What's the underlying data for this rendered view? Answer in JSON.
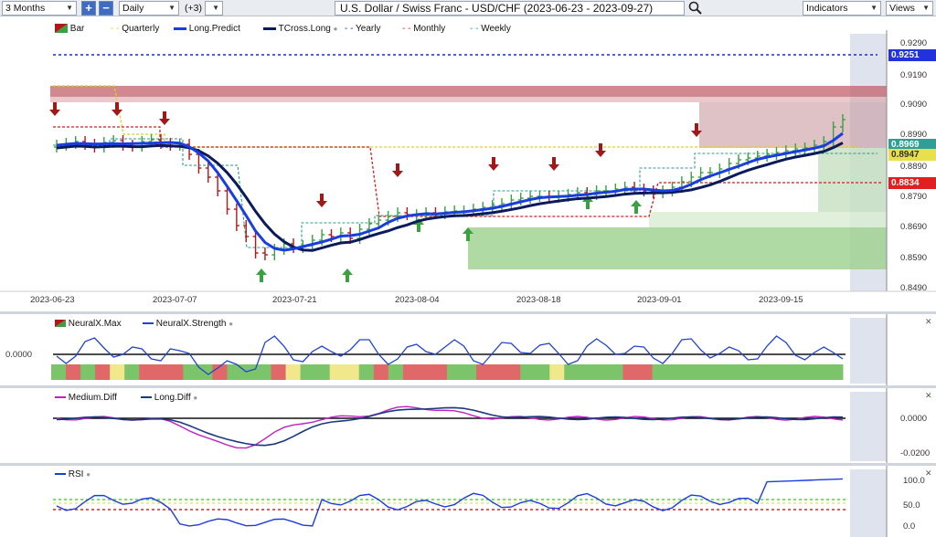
{
  "toolbar": {
    "period": "3 Months",
    "interval": "Daily",
    "plus_count": "(+3)",
    "title": "U.S. Dollar / Swiss Franc - USD/CHF (2023-06-23 - 2023-09-27)",
    "indicators_label": "Indicators",
    "views_label": "Views",
    "zoom_in": "+",
    "zoom_out": "−"
  },
  "main_chart": {
    "legend": [
      "Bar",
      "Quarterly",
      "Long.Predict",
      "TCross.Long",
      "Yearly",
      "Monthly",
      "Weekly"
    ],
    "y_ticks": [
      "0.9290",
      "0.9190",
      "0.9090",
      "0.8990",
      "0.8890",
      "0.8790",
      "0.8690",
      "0.8590",
      "0.8490"
    ],
    "x_ticks": [
      "2023-06-23",
      "2023-07-07",
      "2023-07-21",
      "2023-08-04",
      "2023-08-18",
      "2023-09-01",
      "2023-09-15"
    ],
    "price_tags": [
      {
        "label": "0.9251",
        "color": "#2233dd"
      },
      {
        "label": "0.8969",
        "color": "#2f9e96"
      },
      {
        "label": "0.8947",
        "color": "#e8e04a"
      },
      {
        "label": "0.8834",
        "color": "#e02020"
      }
    ]
  },
  "neural_panel": {
    "legend": [
      "NeuralX.Max",
      "NeuralX.Strength"
    ],
    "y_label": "0.0000"
  },
  "diff_panel": {
    "legend": [
      "Medium.Diff",
      "Long.Diff"
    ],
    "y_ticks": [
      "0.0000",
      "-0.0200"
    ]
  },
  "rsi_panel": {
    "legend": [
      "RSI"
    ],
    "y_ticks": [
      "100.0",
      "50.0",
      "0.0"
    ]
  },
  "colors": {
    "long_predict": "#1a3de0",
    "tcross_long": "#0a1a5a",
    "yearly": "#1a2bd0",
    "monthly": "#d02020",
    "quarterly": "#e0d020",
    "weekly": "#2a9a8a",
    "up_candle": "#3aa040",
    "down_candle": "#b01818"
  },
  "icons": {
    "search": "magnifier-icon",
    "close": "close-icon"
  }
}
